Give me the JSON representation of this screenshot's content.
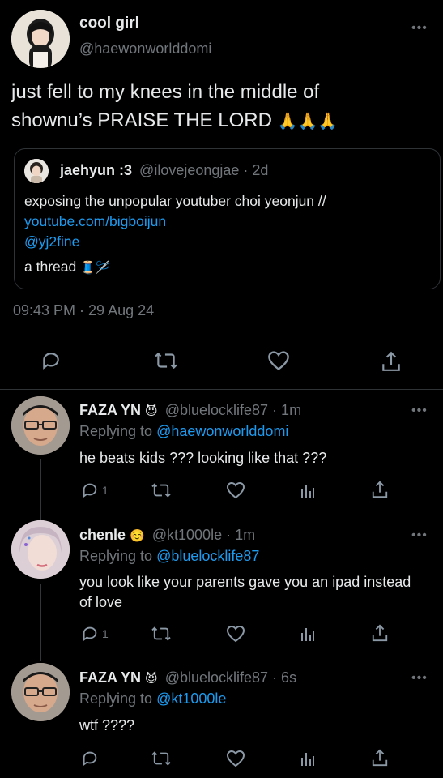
{
  "main_tweet": {
    "display_name": "cool girl",
    "handle": "@haewonworlddomi",
    "text_line1": "just fell to my knees in the middle of",
    "text_line2": "shownu’s PRAISE THE LORD",
    "emoji": "🙏🙏🙏",
    "timestamp": "09:43 PM · 29 Aug 24",
    "more_icon": "more-dots-icon"
  },
  "quote": {
    "display_name": "jaehyun :3",
    "handle": "@ilovejeongjae",
    "time": "· 2d",
    "line1": "exposing the unpopular youtuber choi yeonjun //",
    "link": "youtube.com/bigboijun",
    "mention": "@yj2fine",
    "line4": "a thread",
    "line4_emoji": "🧵🪡"
  },
  "replies": [
    {
      "display_name": "FAZA YN",
      "emoji": "😈",
      "handle": "@bluelocklife87",
      "time": "· 1m",
      "replying_prefix": "Replying to",
      "replying_to": "@haewonworlddomi",
      "text": "he beats kids ??? looking like that ???",
      "reply_count": "1"
    },
    {
      "display_name": "chenle",
      "emoji": "☺️",
      "handle": "@kt1000le",
      "time": "· 1m",
      "replying_prefix": "Replying to",
      "replying_to": "@bluelocklife87",
      "text": "you look like your parents gave you an ipad instead of love",
      "reply_count": "1"
    },
    {
      "display_name": "FAZA YN",
      "emoji": "😈",
      "handle": "@bluelocklife87",
      "time": "· 6s",
      "replying_prefix": "Replying to",
      "replying_to": "@kt1000le",
      "text": "wtf ????",
      "reply_count": ""
    }
  ]
}
